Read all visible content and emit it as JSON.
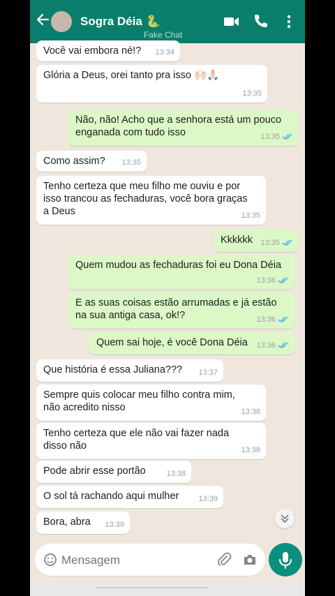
{
  "header": {
    "back_icon": "arrow-left-icon",
    "contact_name": "Sogra Déia 🐍",
    "watermark": "Fake Chat",
    "icons": [
      "videocam-icon",
      "phone-icon",
      "more-vert-icon"
    ],
    "header_color": "#0a7e6d"
  },
  "messages": [
    {
      "dir": "in",
      "text": "Você vai embora né!?",
      "time": "13:34"
    },
    {
      "dir": "in",
      "text": "Glória a Deus, orei tanto pra isso 🙌🏻🙏🏻",
      "time": "13:35"
    },
    {
      "dir": "out",
      "text": "Não, não! Acho que a senhora está um pouco\nenganada com tudo isso",
      "time": "13:35"
    },
    {
      "dir": "in",
      "text": "Como assim?",
      "time": "13:35"
    },
    {
      "dir": "in",
      "text": "Tenho certeza que meu filho me ouviu e por\nisso trancou as fechaduras, você bora graças\na Deus",
      "time": "13:35"
    },
    {
      "dir": "out",
      "text": "Kkkkkk",
      "time": "13:35"
    },
    {
      "dir": "out",
      "text": "Quem mudou as fechaduras foi eu Dona Déia",
      "time": "13:36"
    },
    {
      "dir": "out",
      "text": "E as suas coisas estão arrumadas e já estão\nna sua antiga casa, ok!?",
      "time": "13:36"
    },
    {
      "dir": "out",
      "text": "Quem sai hoje, é você Dona Déia",
      "time": "13:36"
    },
    {
      "dir": "in",
      "text": "Que história é essa Juliana???",
      "time": "13:37"
    },
    {
      "dir": "in",
      "text": "Sempre quis colocar meu filho contra mim,\nnão acredito nisso",
      "time": "13:38"
    },
    {
      "dir": "in",
      "text": "Tenho certeza que ele não vai fazer nada\ndisso não",
      "time": "13:38"
    },
    {
      "dir": "in",
      "text": "Pode abrir esse portão",
      "time": "13:38"
    },
    {
      "dir": "in",
      "text": "O sol tá rachando aqui mulher",
      "time": "13:39"
    },
    {
      "dir": "in",
      "text": "Bora, abra",
      "time": "13:39"
    }
  ],
  "composer": {
    "placeholder": "Mensagem",
    "icons": [
      "emoji-icon",
      "attach-icon",
      "camera-icon",
      "mic-icon"
    ]
  },
  "colors": {
    "incoming": "#ffffff",
    "outgoing": "#dcf8c6",
    "read_ticks": "#4fb6ec",
    "chat_bg": "#efe7dd"
  }
}
